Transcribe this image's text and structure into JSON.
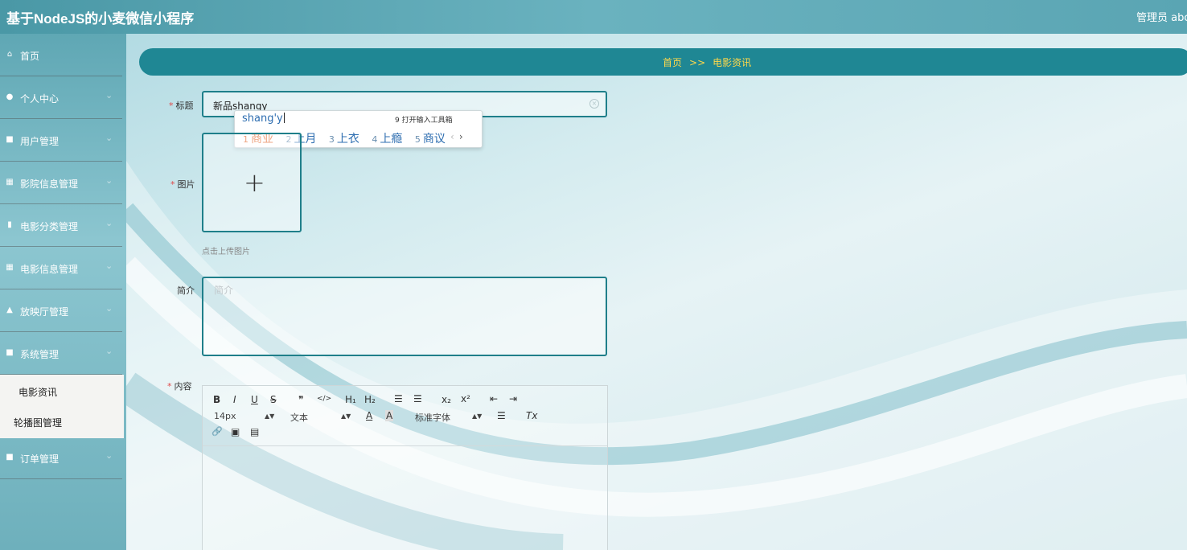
{
  "app": {
    "title": "基于NodeJS的小麦微信小程序",
    "user": "管理员 abo"
  },
  "sidebar": {
    "items": [
      {
        "label": "首页",
        "icon": "home-icon",
        "glyph": "⌂"
      },
      {
        "label": "个人中心",
        "icon": "user-icon",
        "glyph": "●"
      },
      {
        "label": "用户管理",
        "icon": "user-manage-icon",
        "glyph": "■"
      },
      {
        "label": "影院信息管理",
        "icon": "grid-icon",
        "glyph": "▦"
      },
      {
        "label": "电影分类管理",
        "icon": "bar-chart-icon",
        "glyph": "▮"
      },
      {
        "label": "电影信息管理",
        "icon": "grid-icon",
        "glyph": "▦"
      },
      {
        "label": "放映厅管理",
        "icon": "thumbs-up-icon",
        "glyph": "▲"
      },
      {
        "label": "系统管理",
        "icon": "clipboard-icon",
        "glyph": "■"
      },
      {
        "label": "订单管理",
        "icon": "order-icon",
        "glyph": "■"
      }
    ],
    "submenu": [
      "电影资讯",
      "轮播图管理"
    ],
    "chevron": "⌄"
  },
  "breadcrumb": {
    "home": "首页",
    "sep": ">>",
    "current": "电影资讯"
  },
  "form": {
    "title_label": "标题",
    "title_value": "新品shangy",
    "image_label": "图片",
    "upload_hint": "点击上传图片",
    "intro_label": "简介",
    "intro_placeholder": "简介",
    "content_label": "内容"
  },
  "ime": {
    "composition": "shang'y",
    "tool": "9 打开输入工具箱",
    "candidates": [
      {
        "num": "1",
        "text": "商业"
      },
      {
        "num": "2",
        "text": "上月"
      },
      {
        "num": "3",
        "text": "上衣"
      },
      {
        "num": "4",
        "text": "上瘾"
      },
      {
        "num": "5",
        "text": "商议"
      }
    ],
    "prev": "‹",
    "next": "›"
  },
  "editor": {
    "font_size": "14px",
    "paragraph": "文本",
    "font_family": "标准字体",
    "buttons": {
      "bold": "B",
      "italic": "I",
      "underline": "U",
      "strike": "S",
      "quote": "❞",
      "code": "</>",
      "h1": "H₁",
      "h2": "H₂",
      "ol": "☰",
      "ul": "☰",
      "sub": "x₂",
      "sup": "x²",
      "outdent": "⇤",
      "indent": "⇥",
      "color": "A",
      "background": "A",
      "align": "☰",
      "clean": "Tx",
      "link": "🔗",
      "image": "▣",
      "video": "▤"
    }
  },
  "colors": {
    "accent": "#1f8794",
    "breadcrumb_text": "#ffd84a",
    "border": "#1f7f8a"
  }
}
